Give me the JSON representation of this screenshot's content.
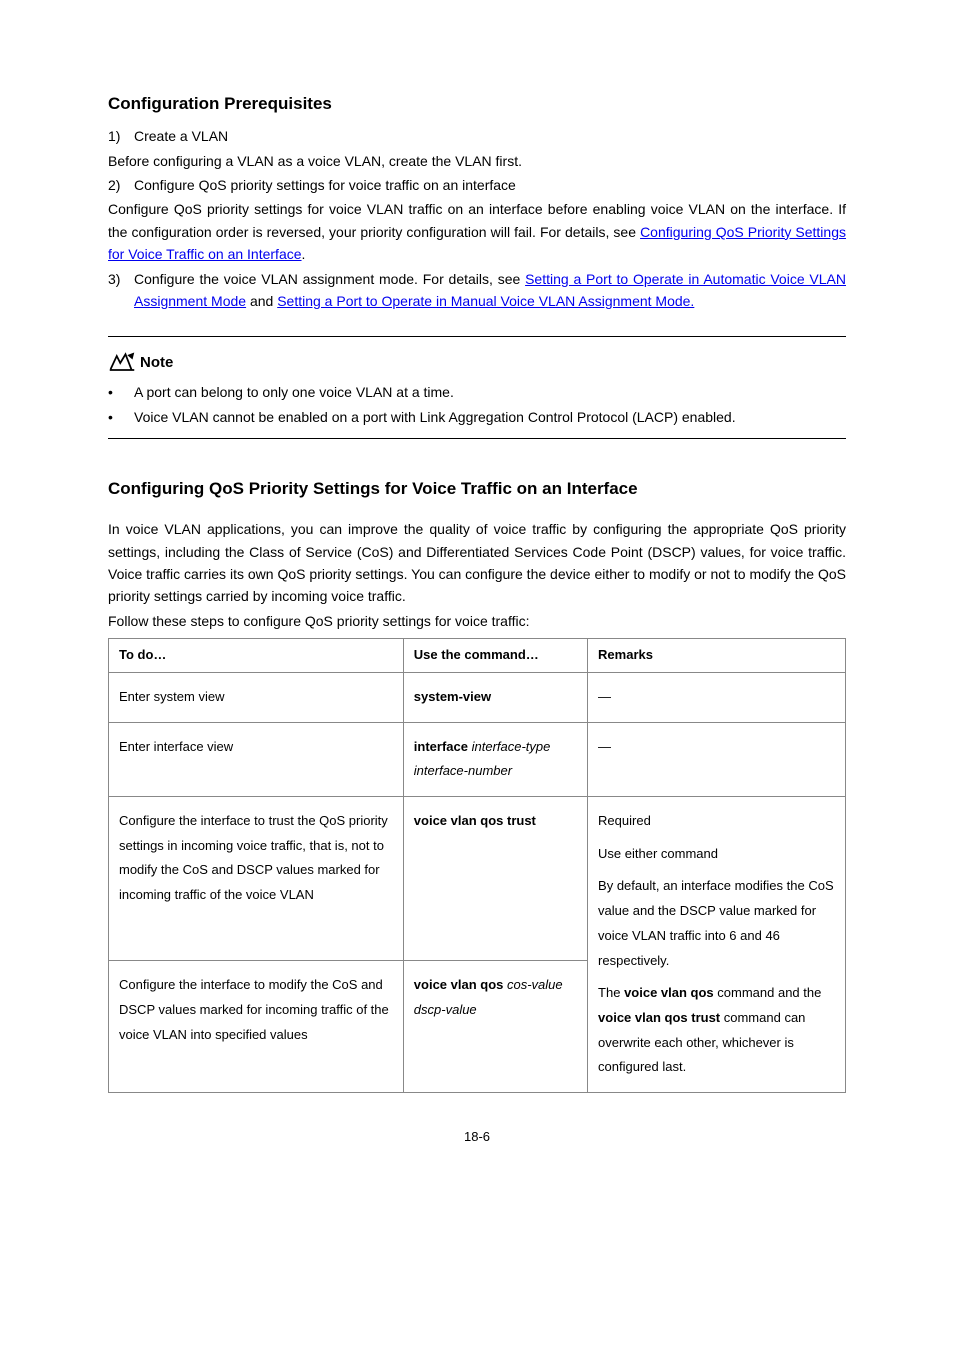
{
  "prereq": {
    "heading": "Configuration Prerequisites",
    "item1_marker": "1)",
    "item1_text": "Create a VLAN",
    "line1": "Before configuring a VLAN as a voice VLAN, create the VLAN first.",
    "item2_marker": "2)",
    "item2_text": "Configure QoS priority settings for voice traffic on an interface",
    "para2a": "Configure QoS priority settings for voice VLAN traffic on an interface before enabling voice VLAN on the interface. If the configuration order is reversed, your priority configuration will fail. For details, see ",
    "link1": "Configuring QoS Priority Settings for Voice Traffic on an Interface",
    "para2b": ".",
    "item3_marker": "3)",
    "item3_a": "Configure the voice VLAN assignment mode. For details, see ",
    "link2": "Setting a Port to Operate in Automatic Voice VLAN Assignment Mode",
    "item3_b": " and ",
    "link3": "Setting a Port to Operate in Manual Voice VLAN Assignment Mode.",
    "note_label": "Note",
    "bullet1": "A port can belong to only one voice VLAN at a time.",
    "bullet2": "Voice VLAN cannot be enabled on a port with Link Aggregation Control Protocol (LACP) enabled."
  },
  "section": {
    "heading": "Configuring QoS Priority Settings for Voice Traffic on an Interface",
    "para1": "In voice VLAN applications, you can improve the quality of voice traffic by configuring the appropriate QoS priority settings, including the Class of Service (CoS) and Differentiated Services Code Point (DSCP) values, for voice traffic. Voice traffic carries its own QoS priority settings. You can configure the device either to modify or not to modify the QoS priority settings carried by incoming voice traffic.",
    "para2": "Follow these steps to configure QoS priority settings for voice traffic:"
  },
  "table": {
    "th1": "To do…",
    "th2": "Use the command…",
    "th3": "Remarks",
    "r1_c1": "Enter system view",
    "r1_c2": "system-view",
    "r1_c3": "—",
    "r2_c1": "Enter interface view",
    "r2_c2_a": "interface",
    "r2_c2_b": " interface-type interface-number",
    "r2_c3": "—",
    "r3_c1": "Configure the interface to trust the QoS priority settings in incoming voice traffic, that is, not to modify the CoS and DSCP values marked for incoming traffic of the voice VLAN",
    "r3_c2": "voice vlan qos trust",
    "r4_c1": "Configure the interface to modify the CoS and DSCP values marked for incoming traffic of the voice VLAN into specified values",
    "r4_c2_a": "voice vlan qos",
    "r4_c2_b": " cos-value dscp-value",
    "rem_1": "Required",
    "rem_2": "Use either command",
    "rem_3": "By default, an interface modifies the CoS value and the DSCP value marked for voice VLAN traffic into 6 and 46 respectively.",
    "rem_4a": "The ",
    "rem_4b": "voice vlan qos",
    "rem_4c": " command and the ",
    "rem_4d": "voice vlan qos trust",
    "rem_4e": " command can overwrite each other, whichever is configured last."
  },
  "page_num": "18-6"
}
